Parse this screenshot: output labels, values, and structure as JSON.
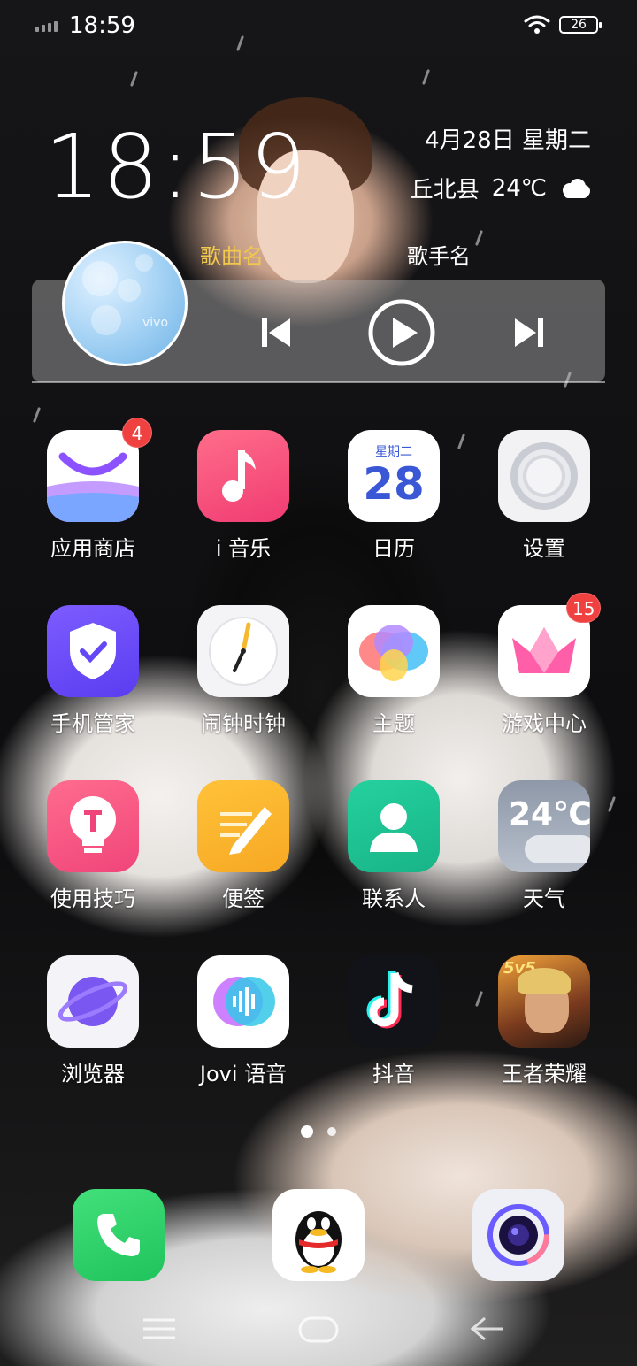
{
  "status_bar": {
    "time": "18:59",
    "battery": "26"
  },
  "clock_widget": {
    "time": "18:59",
    "date": "4月28日 星期二",
    "location": "丘北县",
    "temperature": "24℃",
    "weather_icon": "cloud-icon"
  },
  "music_widget": {
    "song": "歌曲名",
    "artist": "歌手名",
    "disc_brand": "vivo"
  },
  "apps": [
    {
      "label": "应用商店",
      "icon": "app-store-icon",
      "badge": "4"
    },
    {
      "label": "i 音乐",
      "icon": "music-icon",
      "badge": ""
    },
    {
      "label": "日历",
      "icon": "calendar-icon",
      "badge": "",
      "weekday": "星期二",
      "day": "28"
    },
    {
      "label": "设置",
      "icon": "settings-icon",
      "badge": ""
    },
    {
      "label": "手机管家",
      "icon": "phone-manager-icon",
      "badge": ""
    },
    {
      "label": "闹钟时钟",
      "icon": "clock-icon",
      "badge": ""
    },
    {
      "label": "主题",
      "icon": "theme-icon",
      "badge": ""
    },
    {
      "label": "游戏中心",
      "icon": "game-center-icon",
      "badge": "15"
    },
    {
      "label": "使用技巧",
      "icon": "tips-icon",
      "badge": ""
    },
    {
      "label": "便签",
      "icon": "notes-icon",
      "badge": ""
    },
    {
      "label": "联系人",
      "icon": "contacts-icon",
      "badge": ""
    },
    {
      "label": "天气",
      "icon": "weather-icon",
      "badge": "",
      "temp": "24℃"
    },
    {
      "label": "浏览器",
      "icon": "browser-icon",
      "badge": ""
    },
    {
      "label": "Jovi 语音",
      "icon": "voice-assistant-icon",
      "badge": ""
    },
    {
      "label": "抖音",
      "icon": "douyin-icon",
      "badge": ""
    },
    {
      "label": "王者荣耀",
      "icon": "honor-of-kings-icon",
      "badge": "",
      "tag": "5v5"
    }
  ],
  "dock": [
    {
      "icon": "phone-icon"
    },
    {
      "icon": "qq-icon"
    },
    {
      "icon": "camera-icon"
    }
  ],
  "navigation": [
    {
      "icon": "menu-icon"
    },
    {
      "icon": "home-icon"
    },
    {
      "icon": "back-icon"
    }
  ],
  "colors": {
    "badge": "#f04141",
    "song_text": "#f2c94c"
  }
}
